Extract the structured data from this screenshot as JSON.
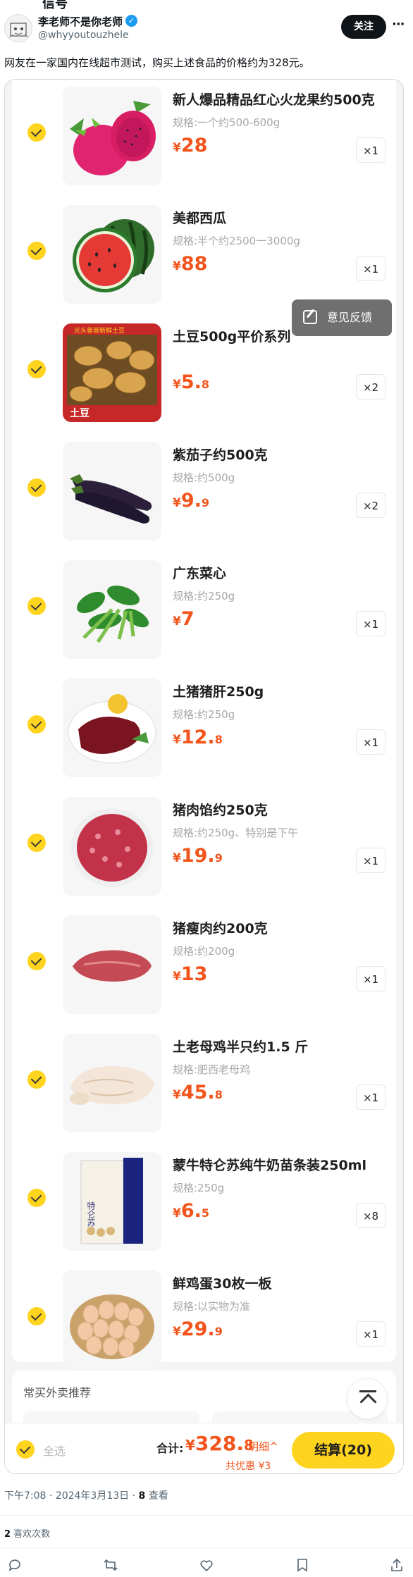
{
  "post": {
    "top_cut_text": "信号",
    "author_name": "李老师不是你老师",
    "handle": "@whyyoutouzhele",
    "follow_label": "关注",
    "more_label": "···",
    "text": "网友在一家国内在线超市测试，购买上述食品的价格约为328元。"
  },
  "cart": {
    "items": [
      {
        "name": "新人爆品精品红心火龙果约500克",
        "spec": "规格:一个约500-600g",
        "yen": "¥",
        "price_int": "28",
        "price_dec": "",
        "qty": "×1",
        "image": "dragon-fruit"
      },
      {
        "name": "美都西瓜",
        "spec": "规格:半个约2500一3000g",
        "yen": "¥",
        "price_int": "88",
        "price_dec": "",
        "qty": "×1",
        "image": "watermelon"
      },
      {
        "name": "土豆500g平价系列",
        "spec": "",
        "yen": "¥",
        "price_int": "5.",
        "price_dec": "8",
        "qty": "×2",
        "image": "potatoes"
      },
      {
        "name": "紫茄子约500克",
        "spec": "规格:约500g",
        "yen": "¥",
        "price_int": "9.",
        "price_dec": "9",
        "qty": "×2",
        "image": "eggplant"
      },
      {
        "name": "广东菜心",
        "spec": "规格:约250g",
        "yen": "¥",
        "price_int": "7",
        "price_dec": "",
        "qty": "×1",
        "image": "choy-sum"
      },
      {
        "name": "土猪猪肝250g",
        "spec": "规格:约250g",
        "yen": "¥",
        "price_int": "12.",
        "price_dec": "8",
        "qty": "×1",
        "image": "pork-liver"
      },
      {
        "name": "猪肉馅约250克",
        "spec": "规格:约250g、特别是下午",
        "yen": "¥",
        "price_int": "19.",
        "price_dec": "9",
        "qty": "×1",
        "image": "minced-pork"
      },
      {
        "name": "猪瘦肉约200克",
        "spec": "规格:约200g",
        "yen": "¥",
        "price_int": "13",
        "price_dec": "",
        "qty": "×1",
        "image": "lean-pork"
      },
      {
        "name": "土老母鸡半只约1.5 斤",
        "spec": "规格:肥西老母鸡",
        "yen": "¥",
        "price_int": "45.",
        "price_dec": "8",
        "qty": "×1",
        "image": "chicken"
      },
      {
        "name": "蒙牛特仑苏纯牛奶苗条装250ml",
        "spec": "规格:250g",
        "yen": "¥",
        "price_int": "6.",
        "price_dec": "5",
        "qty": "×8",
        "image": "milk"
      },
      {
        "name": "鲜鸡蛋30枚一板",
        "spec": "规格:以实物为准",
        "yen": "¥",
        "price_int": "29.",
        "price_dec": "9",
        "qty": "×1",
        "image": "eggs"
      }
    ],
    "potato_banner_top": "光头爸爸新鲜土豆",
    "potato_banner_bottom": "土豆",
    "milk_box_text": "特仑苏",
    "feedback_label": "意见反馈",
    "recommend_title": "常买外卖推荐",
    "select_all_label": "全选",
    "total_label": "合计:",
    "total_yen": "¥",
    "total_int": "328.",
    "total_dec": "8",
    "detail_label": "明细^",
    "discount_label": "共优惠 ¥3",
    "checkout_label": "结算(20)"
  },
  "footer": {
    "time_date": "下午7:08 · 2024年3月13日 · ",
    "views_count": "8",
    "views_label": " 查看",
    "likes_count": "2",
    "likes_label": " 喜欢次数"
  },
  "colors": {
    "accent": "#ffd41e",
    "price": "#f2541b",
    "verified": "#1d9bf0"
  }
}
